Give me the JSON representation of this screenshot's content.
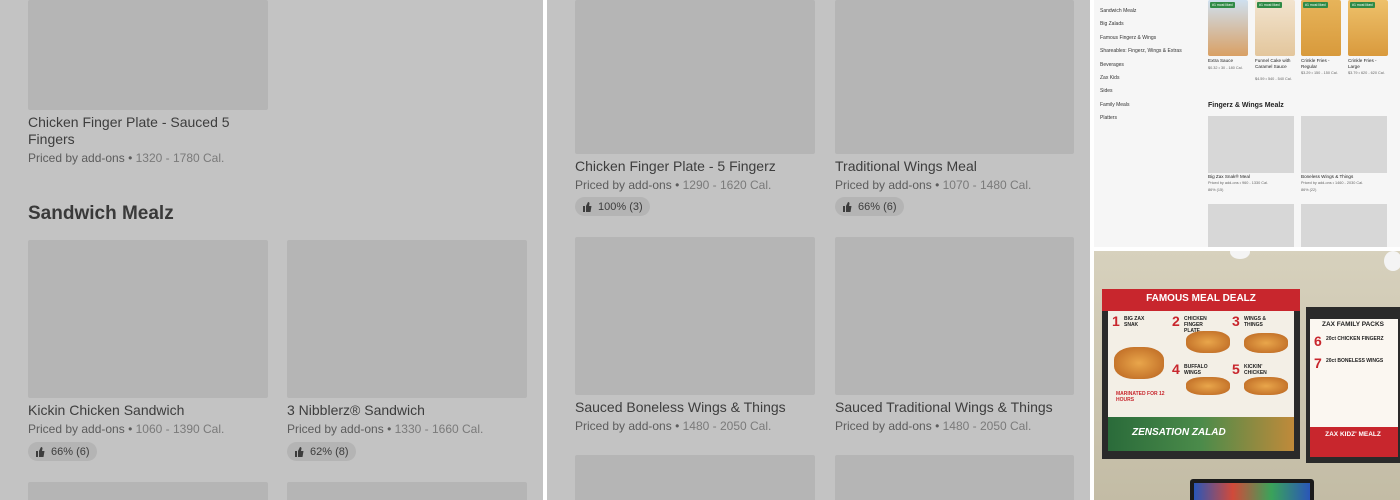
{
  "panel1": {
    "cards": [
      {
        "name": "Chicken Finger Plate - Sauced 5 Fingers",
        "price": "Priced by add-ons",
        "cal": "1320 - 1780 Cal.",
        "rating": ""
      },
      {
        "name": "Kickin Chicken Sandwich",
        "price": "Priced by add-ons",
        "cal": "1060 - 1390 Cal.",
        "rating": "66% (6)"
      },
      {
        "name": "3 Nibblerz® Sandwich",
        "price": "Priced by add-ons",
        "cal": "1330 - 1660 Cal.",
        "rating": "62% (8)"
      }
    ],
    "section_title": "Sandwich Mealz"
  },
  "panel2": {
    "cards": [
      {
        "name": "Chicken Finger Plate - 5 Fingerz",
        "price": "Priced by add-ons",
        "cal": "1290 - 1620 Cal.",
        "rating": "100% (3)"
      },
      {
        "name": "Traditional Wings Meal",
        "price": "Priced by add-ons",
        "cal": "1070 - 1480 Cal.",
        "rating": "66% (6)"
      },
      {
        "name": "Sauced Boneless Wings & Things",
        "price": "Priced by add-ons",
        "cal": "1480 - 2050 Cal.",
        "rating": ""
      },
      {
        "name": "Sauced Traditional Wings & Things",
        "price": "Priced by add-ons",
        "cal": "1480 - 2050 Cal.",
        "rating": ""
      }
    ]
  },
  "panel3": {
    "categories": [
      "Sandwich Mealz",
      "Big Zalads",
      "Famous Fingerz & Wings",
      "Shareables: Fingerz, Wings & Extras",
      "Beverages",
      "Zax Kids",
      "Sides",
      "Family Meals",
      "Platters"
    ],
    "tag": "#1 most liked",
    "items": [
      {
        "name": "Extra Sauce",
        "meta": "$0.32 • 30 - 180 Cal."
      },
      {
        "name": "Funnel Cake with Caramel Sauce",
        "meta": "$4.59 • 540 - 540 Cal."
      },
      {
        "name": "Crinkle Fries - Regular",
        "meta": "$3.29 • 150 - 150 Cal."
      },
      {
        "name": "Crinkle Fries - Large",
        "meta": "$3.79 • 620 - 620 Cal."
      }
    ],
    "section": "Fingerz & Wings Mealz",
    "lower_items": [
      {
        "name": "Big Zax Snak® Meal",
        "meta": "Priced by add-ons • 960 - 1330 Cal.",
        "rating": "86% (15)"
      },
      {
        "name": "Boneless Wings & Things",
        "meta": "Priced by add-ons • 1460 - 2030 Cal.",
        "rating": "86% (22)"
      }
    ]
  },
  "panel4": {
    "board_title": "FAMOUS MEAL DEALZ",
    "board_items": [
      {
        "num": "1",
        "label": "BIG ZAX SNAK"
      },
      {
        "num": "2",
        "label": "CHICKEN FINGER PLATE"
      },
      {
        "num": "3",
        "label": "WINGS & THINGS"
      },
      {
        "num": "4",
        "label": "BUFFALO WINGS"
      },
      {
        "num": "5",
        "label": "KICKIN' CHICKEN"
      }
    ],
    "marinated": "MARINATED FOR 12 HOURS",
    "zalad": "ZENSATION ZALAD",
    "family_title": "ZAX FAMILY PACKS",
    "family_items": [
      {
        "num": "6",
        "label": "20ct CHICKEN FINGERZ"
      },
      {
        "num": "7",
        "label": "20ct BONELESS WINGS"
      }
    ],
    "kidz": "ZAX KIDZ' MEALZ"
  }
}
